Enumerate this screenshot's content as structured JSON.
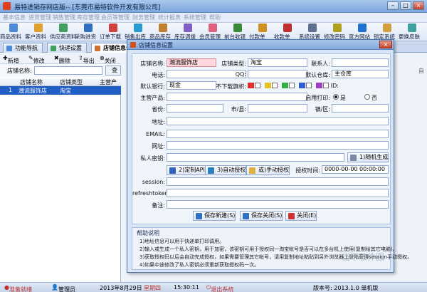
{
  "window": {
    "title": "易特进销存网店版-- [东莞市易特软件开发有限公司]"
  },
  "menu": [
    "基本信息",
    "进货管理",
    "销售管理",
    "库存管理",
    "会员等管理",
    "财务管理",
    "统计报表",
    "系统管理",
    "帮助"
  ],
  "toolbar": [
    "商品资料",
    "客户资料",
    "供应商资料",
    "采购进货",
    "订单下载",
    "销售出库",
    "商品库存",
    "库存调拨",
    "会员管理",
    "前台收银",
    "付款单",
    "收款单",
    "系统设置",
    "修改密码",
    "官方网站",
    "锁定系统",
    "更换皮肤"
  ],
  "tabs": [
    "功能导航",
    "快递设置",
    "店铺信息设置"
  ],
  "leftpane": {
    "buttons": {
      "add": "新增",
      "edit": "修改",
      "delete": "删除",
      "export": "导出",
      "close": "关闭"
    },
    "search_label": "店铺名称:",
    "search_button": "查",
    "columns": [
      "店铺名称",
      "店铺类型",
      "主营产"
    ],
    "rows": [
      {
        "num": "1",
        "name": "潮流服饰店",
        "type": "淘宝"
      }
    ]
  },
  "right_more": "自",
  "dialog": {
    "title": "店铺信息设置",
    "labels": {
      "shop_name": "店铺名称:",
      "shop_type": "店铺类型:",
      "contact": "联系人:",
      "phone": "电话:",
      "qq": "QQ:",
      "default_warehouse": "默认仓库:",
      "default_bank": "默认银行:",
      "no_download_flag": "不下载旗帜:",
      "id": "ID:",
      "main_products": "主营产品:",
      "enable_print": "启用打印:",
      "province": "省份:",
      "city": "市/县:",
      "district": "镇/区:",
      "address": "地址:",
      "email": "EMAIL:",
      "website": "网址:",
      "private_key": "私人密钥:",
      "session": "session:",
      "refreshtoken": "refreshtoken:",
      "remark": "备注:",
      "auth_time": "授权时间:"
    },
    "values": {
      "shop_name": "潮流服饰店",
      "shop_type": "淘宝",
      "default_warehouse": "主仓库",
      "default_bank": "现金",
      "auth_time": "0000-00-00 00:00:00"
    },
    "radio": {
      "yes": "是",
      "no": "否",
      "selected": "yes"
    },
    "buttons": {
      "random_gen": "1)随机生成",
      "custom_api": "2)定制API",
      "auto_auth": "3)自动授权",
      "manual_auth": "或)手动授权",
      "save_new": "保存新建(S)",
      "save_close": "保存关闭(S)",
      "close": "关闭(E)"
    },
    "help": {
      "title": "帮助说明",
      "lines": [
        "1)地址信息可以用于快递单打印调用。",
        "2)输入或生成一个私人密钥，用于加密，该密钥可用于授权同一淘宝帐号是否可以在多台机上使用(复制给其它电脑)。",
        "3)获取授权码以后会自动完成授权，如果需要管理其它帐号，请用复制地址粘贴到另外浏览器上登陆获得session手动授权。",
        "4)如果中途修改了私人密钥必须重新获取授权码一次。"
      ]
    }
  },
  "status": {
    "state": "准备就绪",
    "user": "管理员",
    "date": "2013年8月29日",
    "weekday": "星期四",
    "time": "15:30:11",
    "exit": "退出系统",
    "version": "版本号: 2013.1.0 单机版"
  },
  "watermark": "当下软件园"
}
